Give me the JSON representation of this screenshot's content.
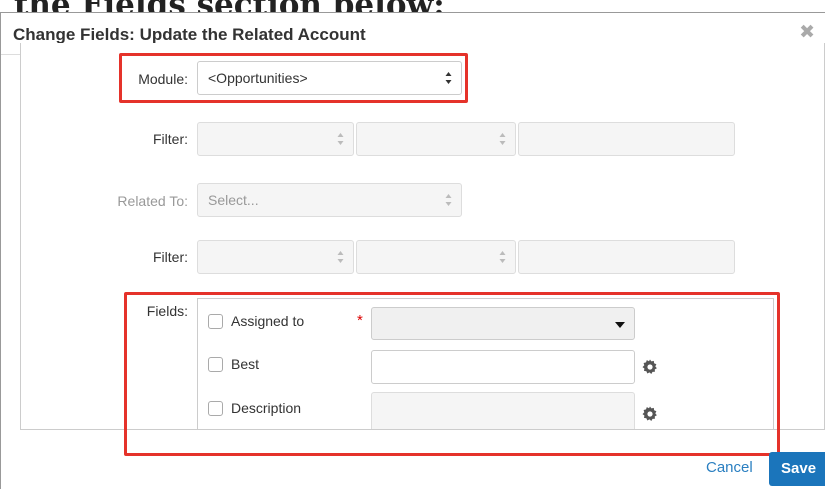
{
  "background_heading": "the Fields section below:",
  "dialog": {
    "title": "Change Fields: Update the Related Account",
    "close_icon": "close-icon"
  },
  "form": {
    "module": {
      "label": "Module:",
      "value": "<Opportunities>"
    },
    "filter1": {
      "label": "Filter:"
    },
    "related_to": {
      "label": "Related To:",
      "placeholder": "Select..."
    },
    "filter2": {
      "label": "Filter:"
    },
    "fields": {
      "label": "Fields:",
      "rows": [
        {
          "label": "Assigned to",
          "required": "*"
        },
        {
          "label": "Best"
        },
        {
          "label": "Description"
        }
      ]
    }
  },
  "footer": {
    "cancel": "Cancel",
    "save": "Save"
  },
  "colors": {
    "highlight": "#e5322a",
    "primary": "#1b75bb",
    "link": "#2a7fc1",
    "required": "#dd0000"
  }
}
